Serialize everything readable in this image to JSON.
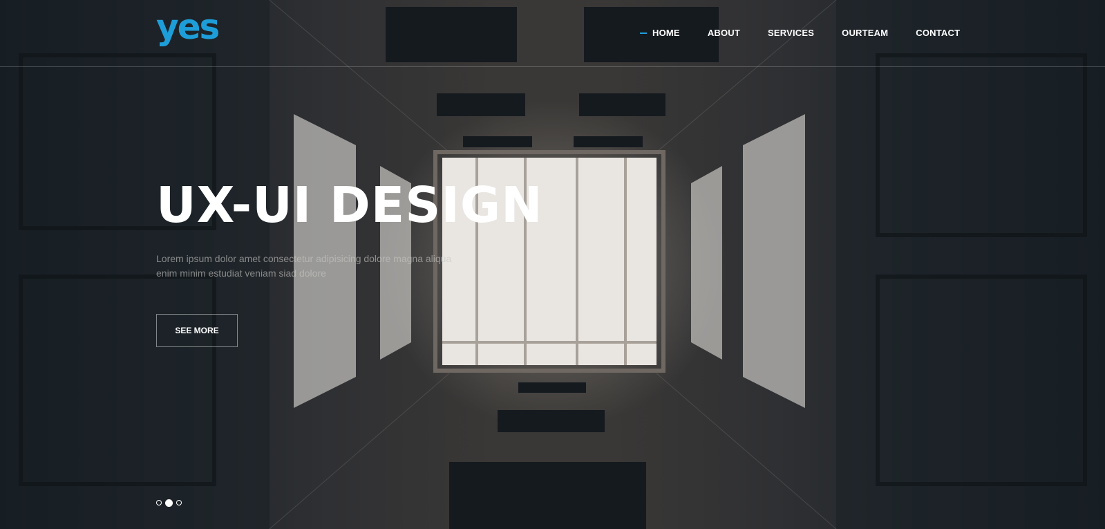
{
  "brand": {
    "logo_text": "yes",
    "accent_color": "#1e9ed9"
  },
  "nav": {
    "items": [
      {
        "label": "HOME",
        "active": true
      },
      {
        "label": "ABOUT",
        "active": false
      },
      {
        "label": "SERVICES",
        "active": false
      },
      {
        "label": "OURTEAM",
        "active": false
      },
      {
        "label": "CONTACT",
        "active": false
      }
    ]
  },
  "hero": {
    "title": "UX-UI DESIGN",
    "subtitle": "Lorem ipsum dolor amet consectetur adipisicing dolore magna aliqua enim minim estudiat veniam siad dolore",
    "cta_label": "SEE MORE",
    "background": "architecture-courtyard-photo"
  },
  "slider": {
    "slide_count": 3,
    "active_index": 1
  }
}
